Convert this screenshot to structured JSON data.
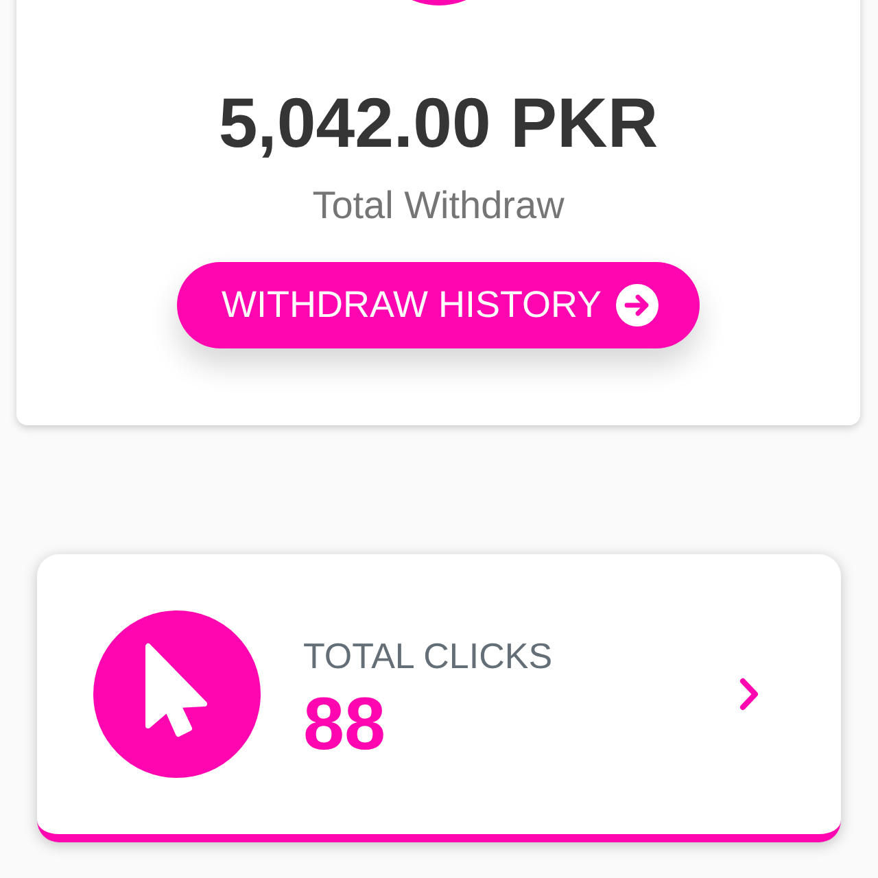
{
  "withdraw_card": {
    "amount": "5,042.00 PKR",
    "label": "Total Withdraw",
    "button": {
      "label": "WITHDRAW HISTORY"
    }
  },
  "stats": [
    {
      "label": "TOTAL CLICKS",
      "value": "88"
    }
  ]
}
